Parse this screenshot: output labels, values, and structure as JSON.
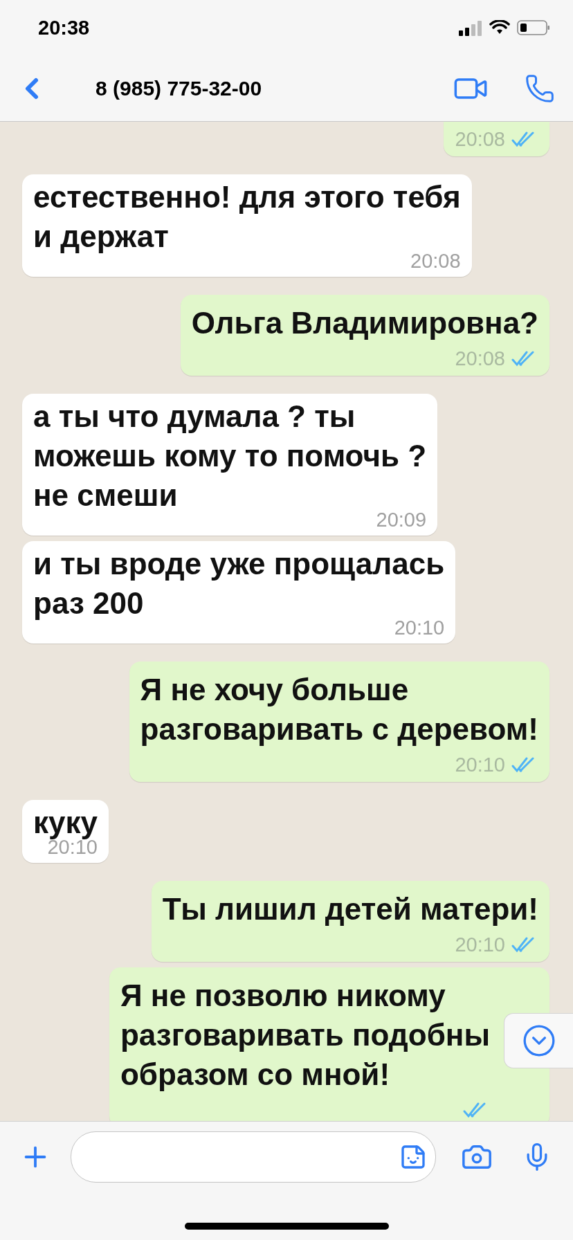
{
  "status_bar": {
    "time": "20:38"
  },
  "header": {
    "title": "8 (985) 775-32-00"
  },
  "messages": [
    {
      "kind": "outgoing",
      "time": "20:08",
      "read": true
    },
    {
      "kind": "incoming",
      "lines": [
        "естественно! для этого тебя",
        "и держат"
      ],
      "time": "20:08"
    },
    {
      "kind": "outgoing",
      "lines": [
        "Ольга Владимировна?"
      ],
      "time": "20:08",
      "read": true
    },
    {
      "kind": "incoming",
      "lines": [
        "а ты что думала ? ты",
        "можешь кому то помочь ?",
        "не смеши"
      ],
      "time": "20:09"
    },
    {
      "kind": "incoming",
      "lines": [
        "и ты вроде уже прощалась",
        "раз 200"
      ],
      "time": "20:10"
    },
    {
      "kind": "outgoing",
      "lines": [
        "Я не хочу больше",
        "разговаривать с деревом!"
      ],
      "time": "20:10",
      "read": true
    },
    {
      "kind": "incoming",
      "lines": [
        "куку"
      ],
      "time": "20:10"
    },
    {
      "kind": "outgoing",
      "lines": [
        "Ты лишил детей матери!"
      ],
      "time": "20:10",
      "read": true
    },
    {
      "kind": "outgoing",
      "lines": [
        "Я не позволю никому",
        "разговаривать подобны",
        "образом со мной!"
      ],
      "read": true
    }
  ]
}
